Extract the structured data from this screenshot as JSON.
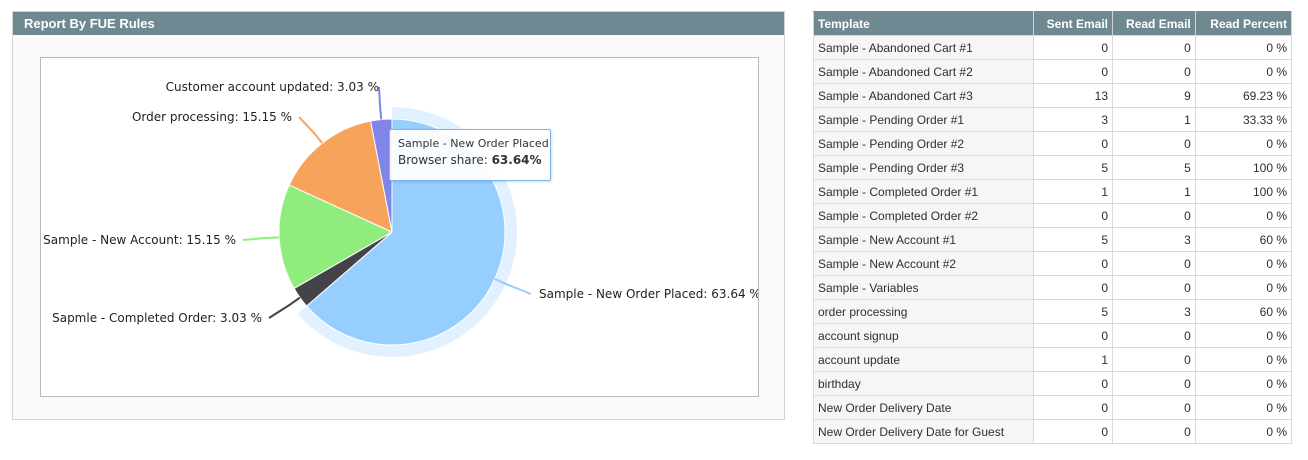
{
  "panel": {
    "title": "Report By FUE Rules"
  },
  "chart_data": {
    "type": "pie",
    "title": "",
    "slices": [
      {
        "name": "Sample - New Order Placed",
        "value": 63.64,
        "label": "Sample - New Order Placed: 63.64 %",
        "color": "#95ceff"
      },
      {
        "name": "Sapmle - Completed Order",
        "value": 3.03,
        "label": "Sapmle - Completed Order: 3.03 %",
        "color": "#434348"
      },
      {
        "name": "Sample - New Account",
        "value": 15.15,
        "label": "Sample - New Account: 15.15 %",
        "color": "#90ed7d"
      },
      {
        "name": "Order processing",
        "value": 15.15,
        "label": "Order processing: 15.15 %",
        "color": "#f7a35c"
      },
      {
        "name": "Customer account updated",
        "value": 3.03,
        "label": "Customer account updated: 3.03 %",
        "color": "#8085e9"
      }
    ],
    "tooltip": {
      "series": "Sample - New Order Placed",
      "label": "Browser share: ",
      "value": "63.64%"
    }
  },
  "table": {
    "columns": [
      "Template",
      "Sent Email",
      "Read Email",
      "Read Percent"
    ],
    "rows": [
      [
        "Sample - Abandoned Cart #1",
        "0",
        "0",
        "0 %"
      ],
      [
        "Sample - Abandoned Cart #2",
        "0",
        "0",
        "0 %"
      ],
      [
        "Sample - Abandoned Cart #3",
        "13",
        "9",
        "69.23 %"
      ],
      [
        "Sample - Pending Order #1",
        "3",
        "1",
        "33.33 %"
      ],
      [
        "Sample - Pending Order #2",
        "0",
        "0",
        "0 %"
      ],
      [
        "Sample - Pending Order #3",
        "5",
        "5",
        "100 %"
      ],
      [
        "Sample - Completed Order #1",
        "1",
        "1",
        "100 %"
      ],
      [
        "Sample - Completed Order #2",
        "0",
        "0",
        "0 %"
      ],
      [
        "Sample - New Account #1",
        "5",
        "3",
        "60 %"
      ],
      [
        "Sample - New Account #2",
        "0",
        "0",
        "0 %"
      ],
      [
        "Sample - Variables",
        "0",
        "0",
        "0 %"
      ],
      [
        "order processing",
        "5",
        "3",
        "60 %"
      ],
      [
        "account signup",
        "0",
        "0",
        "0 %"
      ],
      [
        "account update",
        "1",
        "0",
        "0 %"
      ],
      [
        "birthday",
        "0",
        "0",
        "0 %"
      ],
      [
        "New Order Delivery Date",
        "0",
        "0",
        "0 %"
      ],
      [
        "New Order Delivery Date for Guest",
        "0",
        "0",
        "0 %"
      ]
    ]
  }
}
